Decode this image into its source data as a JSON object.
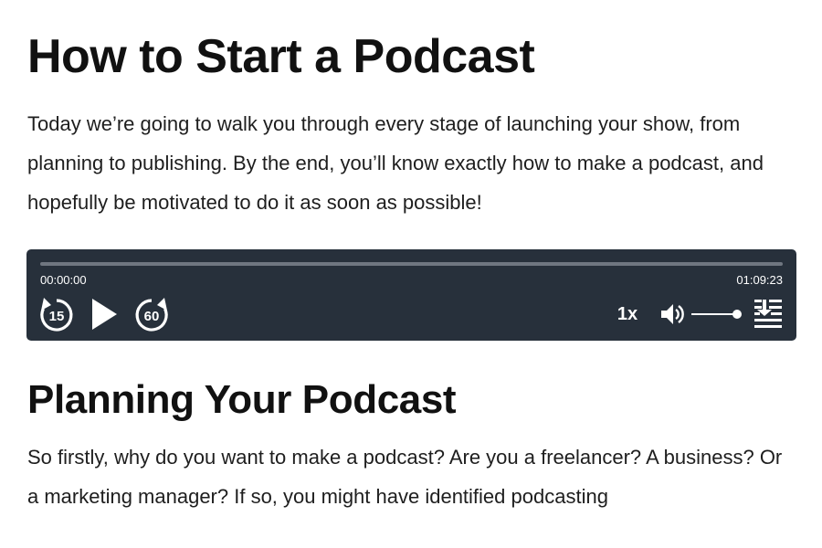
{
  "article": {
    "title": "How to Start a Podcast",
    "intro": "Today we’re going to walk you through every stage of launching your show, from planning to publishing. By the end, you’ll know exactly how to make a podcast, and hopefully be motivated to do it as soon as possible!",
    "section_heading": "Planning Your Podcast",
    "section_text": "So firstly, why do you want to make a podcast? Are you a freelancer?  A business? Or a marketing manager? If so, you might have identified podcasting"
  },
  "player": {
    "current_time": "00:00:00",
    "total_time": "01:09:23",
    "rewind_label": "15",
    "forward_label": "60",
    "speed_label": "1x",
    "progress_fraction": 0,
    "volume_fraction": 1,
    "colors": {
      "background": "#27303b",
      "track": "#6f7680",
      "foreground": "#ffffff"
    },
    "icons": {
      "rewind": "rewind-15-icon",
      "play": "play-icon",
      "forward": "forward-60-icon",
      "volume": "volume-icon",
      "download": "download-icon"
    }
  }
}
